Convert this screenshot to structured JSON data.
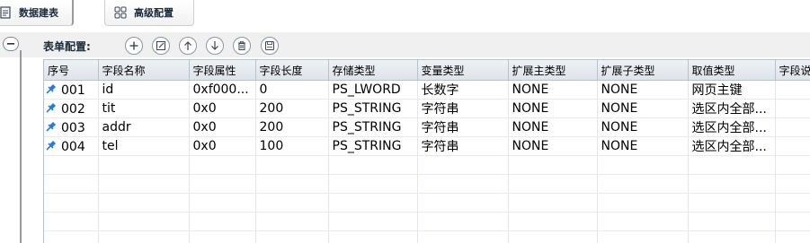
{
  "tabs": [
    {
      "label": "数据建表",
      "icon": "document-icon"
    },
    {
      "label": "高级配置",
      "icon": "grid-icon"
    }
  ],
  "form_config": {
    "label": "表单配置:",
    "toolbar": [
      "add-icon",
      "edit-icon",
      "move-up-icon",
      "move-down-icon",
      "delete-icon",
      "save-icon"
    ]
  },
  "table": {
    "columns": [
      "序号",
      "字段名称",
      "字段属性",
      "字段长度",
      "存储类型",
      "变量类型",
      "扩展主类型",
      "扩展子类型",
      "取值类型",
      "字段说"
    ],
    "rows": [
      {
        "seq": "001",
        "name": "id",
        "attr": "0xf000...",
        "length": "0",
        "storage": "PS_LWORD",
        "var_type": "长数字",
        "ext_main": "NONE",
        "ext_sub": "NONE",
        "value_type": "网页主键",
        "desc": ""
      },
      {
        "seq": "002",
        "name": "tit",
        "attr": "0x0",
        "length": "200",
        "storage": "PS_STRING",
        "var_type": "字符串",
        "ext_main": "NONE",
        "ext_sub": "NONE",
        "value_type": "选区内全部...",
        "desc": ""
      },
      {
        "seq": "003",
        "name": "addr",
        "attr": "0x0",
        "length": "200",
        "storage": "PS_STRING",
        "var_type": "字符串",
        "ext_main": "NONE",
        "ext_sub": "NONE",
        "value_type": "选区内全部...",
        "desc": ""
      },
      {
        "seq": "004",
        "name": "tel",
        "attr": "0x0",
        "length": "100",
        "storage": "PS_STRING",
        "var_type": "字符串",
        "ext_main": "NONE",
        "ext_sub": "NONE",
        "value_type": "选区内全部...",
        "desc": ""
      }
    ]
  },
  "colors": {
    "pin": "#2b7bd6",
    "header_bg": "#e3e9ef",
    "icon_stroke": "#3a4656"
  }
}
